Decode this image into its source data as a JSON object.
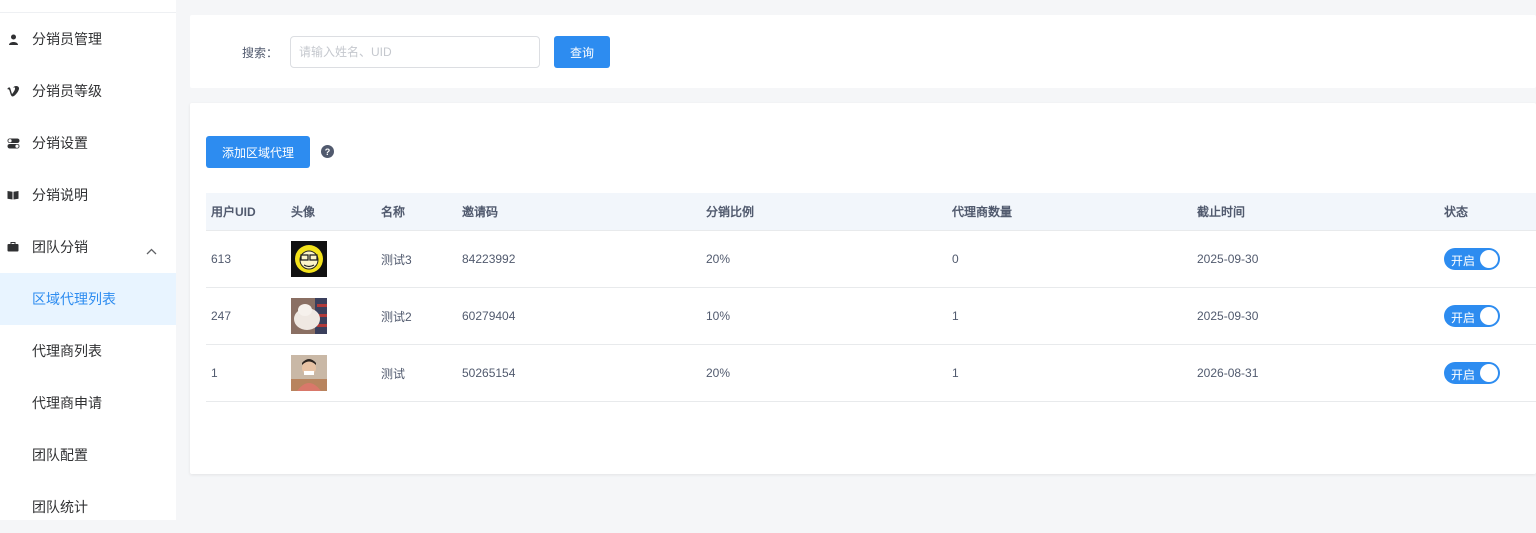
{
  "sidebar": {
    "items": [
      {
        "label": "分销员管理",
        "icon": "user-icon"
      },
      {
        "label": "分销员等级",
        "icon": "vimeo-v-icon"
      },
      {
        "label": "分销设置",
        "icon": "toggle-icon"
      },
      {
        "label": "分销说明",
        "icon": "book-icon"
      },
      {
        "label": "团队分销",
        "icon": "briefcase-icon",
        "expanded": true
      },
      {
        "label": "区域代理列表",
        "active": true
      },
      {
        "label": "代理商列表"
      },
      {
        "label": "代理商申请"
      },
      {
        "label": "团队配置"
      },
      {
        "label": "团队统计"
      }
    ]
  },
  "search": {
    "label": "搜索：",
    "placeholder": "请输入姓名、UID",
    "value": "",
    "button": "查询"
  },
  "toolbar": {
    "add_button": "添加区域代理",
    "help_icon": "question-circle-icon"
  },
  "table": {
    "columns": [
      "用户UID",
      "头像",
      "名称",
      "邀请码",
      "分销比例",
      "代理商数量",
      "截止时间",
      "状态"
    ],
    "rows": [
      {
        "uid": "613",
        "name": "测试3",
        "code": "84223992",
        "ratio": "20%",
        "count": "0",
        "deadline": "2025-09-30",
        "status": "开启",
        "avatar": "yellow-cartoon-avatar"
      },
      {
        "uid": "247",
        "name": "测试2",
        "code": "60279404",
        "ratio": "10%",
        "count": "1",
        "deadline": "2025-09-30",
        "status": "开启",
        "avatar": "fluffy-cat-avatar"
      },
      {
        "uid": "1",
        "name": "测试",
        "code": "50265154",
        "ratio": "20%",
        "count": "1",
        "deadline": "2026-08-31",
        "status": "开启",
        "avatar": "person-photo-avatar"
      }
    ]
  },
  "colors": {
    "primary": "#2d8cf0",
    "active_bg": "#e8f4ff",
    "page_bg": "#f5f6f8"
  }
}
